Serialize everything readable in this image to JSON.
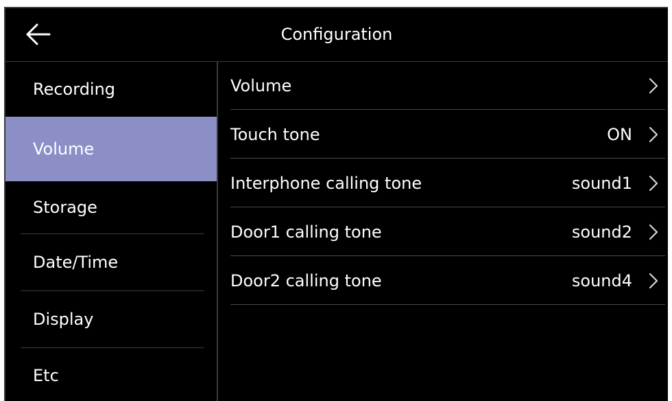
{
  "header": {
    "title": "Configuration",
    "back_icon": "arrow-left-icon"
  },
  "sidebar": {
    "selected": "Volume",
    "active_color": "#8b8fc6",
    "items": [
      {
        "label": "Recording"
      },
      {
        "label": "Volume"
      },
      {
        "label": "Storage"
      },
      {
        "label": "Date/Time"
      },
      {
        "label": "Display"
      },
      {
        "label": "Etc"
      }
    ]
  },
  "settings": {
    "chevron_icon": "chevron-right-icon",
    "rows": [
      {
        "label": "Volume",
        "value": ""
      },
      {
        "label": "Touch tone",
        "value": "ON"
      },
      {
        "label": "Interphone calling tone",
        "value": "sound1"
      },
      {
        "label": "Door1 calling tone",
        "value": "sound2"
      },
      {
        "label": "Door2 calling tone",
        "value": "sound4"
      }
    ]
  }
}
